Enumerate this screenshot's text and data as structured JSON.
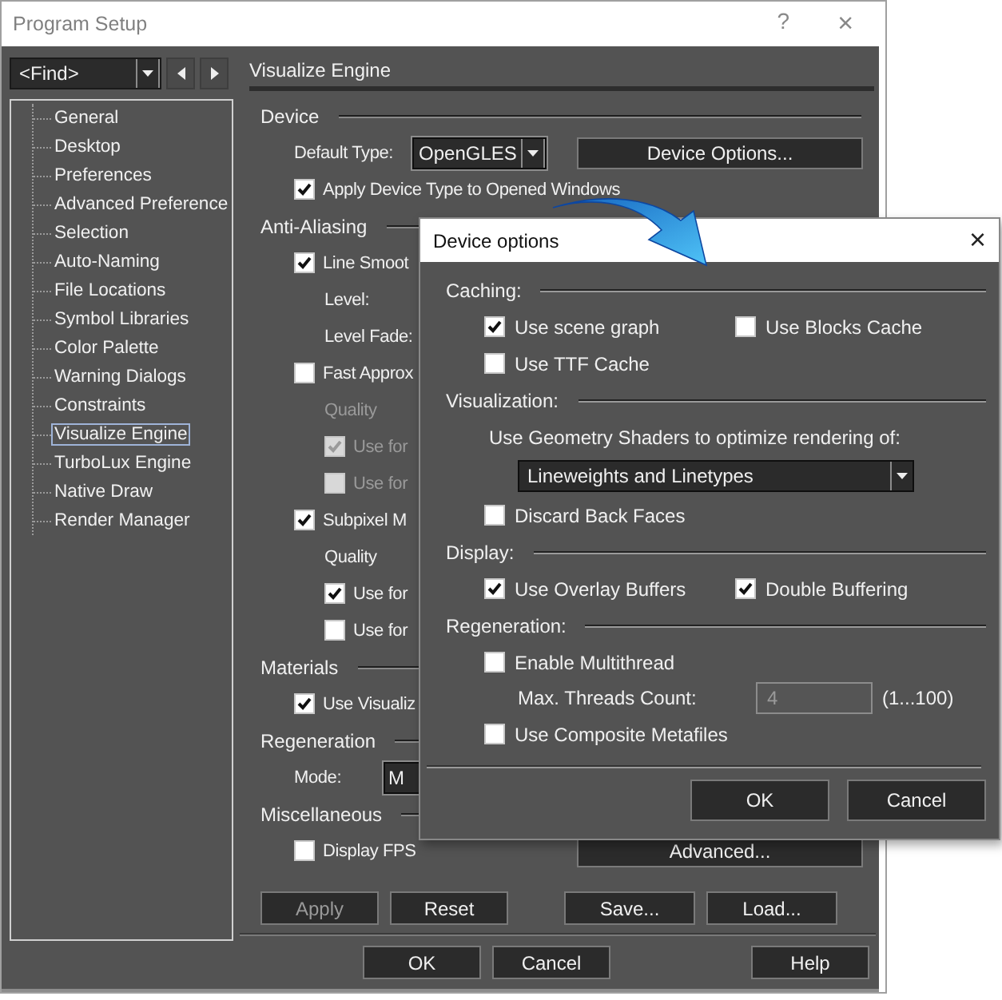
{
  "window": {
    "title": "Program Setup",
    "help": "?",
    "close": "×"
  },
  "finder": {
    "value": "<Find>"
  },
  "tree": [
    {
      "label": "General",
      "selected": false
    },
    {
      "label": "Desktop",
      "selected": false
    },
    {
      "label": "Preferences",
      "selected": false
    },
    {
      "label": "Advanced Preference",
      "selected": false
    },
    {
      "label": "Selection",
      "selected": false
    },
    {
      "label": "Auto-Naming",
      "selected": false
    },
    {
      "label": "File Locations",
      "selected": false
    },
    {
      "label": "Symbol Libraries",
      "selected": false
    },
    {
      "label": "Color Palette",
      "selected": false
    },
    {
      "label": "Warning Dialogs",
      "selected": false
    },
    {
      "label": "Constraints",
      "selected": false
    },
    {
      "label": "Visualize Engine",
      "selected": true
    },
    {
      "label": "TurboLux Engine",
      "selected": false
    },
    {
      "label": "Native Draw",
      "selected": false
    },
    {
      "label": "Render Manager",
      "selected": false
    }
  ],
  "panel": {
    "title": "Visualize Engine",
    "sections": [
      {
        "title": "Device",
        "rows": [
          {
            "kind": "combo",
            "label": "Default Type:",
            "value": "OpenGLES",
            "button": "Device Options..."
          },
          {
            "kind": "check",
            "label": "Apply Device Type to Opened Windows",
            "checked": true,
            "disabled": false
          }
        ]
      },
      {
        "title": "Anti-Aliasing",
        "rows": [
          {
            "kind": "check",
            "label": "Line Smoot",
            "checked": true,
            "disabled": false
          },
          {
            "kind": "sub_text",
            "label": "Level:",
            "disabled": false
          },
          {
            "kind": "sub_text",
            "label": "Level Fade:",
            "disabled": false
          },
          {
            "kind": "check",
            "label": "Fast Approx",
            "checked": false,
            "disabled": false
          },
          {
            "kind": "sub_text",
            "label": "Quality",
            "disabled": true
          },
          {
            "kind": "sub_check",
            "label": "Use for",
            "checked": true,
            "disabled": true
          },
          {
            "kind": "sub_check",
            "label": "Use for",
            "checked": false,
            "disabled": true
          },
          {
            "kind": "check",
            "label": "Subpixel M",
            "checked": true,
            "disabled": false
          },
          {
            "kind": "sub_text",
            "label": "Quality",
            "disabled": false
          },
          {
            "kind": "sub_check",
            "label": "Use for",
            "checked": true,
            "disabled": false
          },
          {
            "kind": "sub_check",
            "label": "Use for",
            "checked": false,
            "disabled": false
          }
        ]
      },
      {
        "title": "Materials",
        "rows": [
          {
            "kind": "check",
            "label": "Use Visualiz",
            "checked": true,
            "disabled": false
          }
        ]
      },
      {
        "title": "Regeneration",
        "rows": [
          {
            "kind": "combo",
            "label": "Mode:",
            "value": "M"
          }
        ]
      },
      {
        "title": "Miscellaneous",
        "rows": [
          {
            "kind": "check",
            "label": "Display FPS",
            "checked": false,
            "disabled": false,
            "button": "Advanced..."
          }
        ]
      }
    ]
  },
  "actions": [
    {
      "label": "Apply",
      "disabled": true
    },
    {
      "label": "Reset",
      "disabled": false
    },
    {
      "label": "Save...",
      "disabled": false
    },
    {
      "label": "Load...",
      "disabled": false
    }
  ],
  "footer": [
    {
      "label": "OK"
    },
    {
      "label": "Cancel"
    },
    {
      "label": "Help"
    }
  ],
  "dialog": {
    "title": "Device options",
    "close": "×",
    "sections": [
      {
        "title": "Caching:",
        "rows": [
          {
            "kind": "checks",
            "items": [
              {
                "label": "Use scene graph",
                "checked": true
              },
              {
                "label": "Use Blocks Cache",
                "checked": false
              }
            ]
          },
          {
            "kind": "checks",
            "items": [
              {
                "label": "Use TTF Cache",
                "checked": false
              }
            ]
          }
        ]
      },
      {
        "title": "Visualization:",
        "rows": [
          {
            "kind": "text",
            "label": "Use Geometry Shaders to optimize rendering of:"
          },
          {
            "kind": "combo",
            "value": "Lineweights and Linetypes"
          },
          {
            "kind": "checks",
            "items": [
              {
                "label": "Discard Back Faces",
                "checked": false
              }
            ]
          }
        ]
      },
      {
        "title": "Display:",
        "rows": [
          {
            "kind": "checks",
            "items": [
              {
                "label": "Use Overlay Buffers",
                "checked": true
              },
              {
                "label": "Double Buffering",
                "checked": true
              }
            ]
          }
        ]
      },
      {
        "title": "Regeneration:",
        "rows": [
          {
            "kind": "checks",
            "items": [
              {
                "label": "Enable Multithread",
                "checked": false
              }
            ]
          },
          {
            "kind": "number",
            "label": "Max. Threads Count:",
            "value": "4",
            "disabled": true,
            "hint": "(1...100)"
          },
          {
            "kind": "checks",
            "items": [
              {
                "label": "Use Composite Metafiles",
                "checked": false
              }
            ]
          }
        ]
      }
    ],
    "buttons": [
      {
        "label": "OK"
      },
      {
        "label": "Cancel"
      }
    ]
  }
}
